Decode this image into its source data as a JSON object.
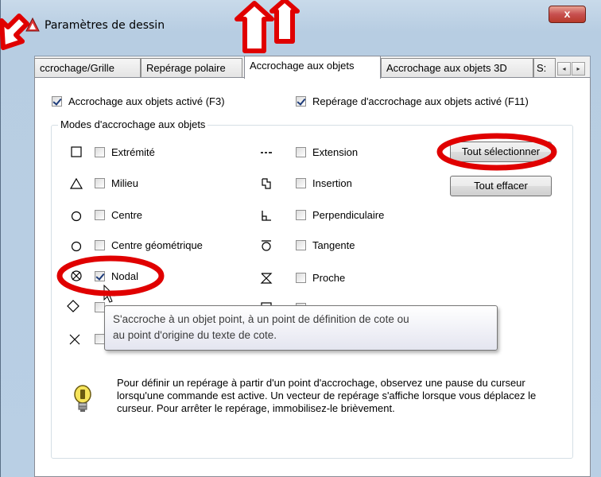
{
  "window": {
    "title": "Paramètres de dessin",
    "close_label": "x",
    "app_icon": "autocad-icon"
  },
  "tabs": [
    {
      "label": "ccrochage/Grille",
      "active": false
    },
    {
      "label": "Repérage polaire",
      "active": false
    },
    {
      "label": "Accrochage aux objets",
      "active": true
    },
    {
      "label": "Accrochage aux objets 3D",
      "active": false
    },
    {
      "label": "S:",
      "active": false
    }
  ],
  "tab_scroll": {
    "left": "◂",
    "right": "▸"
  },
  "options": {
    "osnap_on": {
      "label": "Accrochage aux objets activé (F3)",
      "checked": true
    },
    "tracking_on": {
      "label": "Repérage d'accrochage aux objets activé (F11)",
      "checked": true
    }
  },
  "modes_group_title": "Modes d'accrochage aux objets",
  "modes_left": [
    {
      "symbol": "square-icon",
      "label": "Extrémité",
      "checked": false
    },
    {
      "symbol": "triangle-icon",
      "label": "Milieu",
      "checked": false
    },
    {
      "symbol": "circle-icon",
      "label": "Centre",
      "checked": false
    },
    {
      "symbol": "circle-icon",
      "label": "Centre géométrique",
      "checked": false
    },
    {
      "symbol": "node-icon",
      "label": "Nodal",
      "checked": true
    },
    {
      "symbol": "diamond-icon",
      "label": "",
      "checked": false
    },
    {
      "symbol": "cross-icon",
      "label": "",
      "checked": false
    }
  ],
  "modes_right": [
    {
      "symbol": "extension-icon",
      "label": "Extension",
      "checked": false
    },
    {
      "symbol": "insertion-icon",
      "label": "Insertion",
      "checked": false
    },
    {
      "symbol": "perpendicular-icon",
      "label": "Perpendiculaire",
      "checked": false
    },
    {
      "symbol": "tangent-icon",
      "label": "Tangente",
      "checked": false
    },
    {
      "symbol": "nearest-icon",
      "label": "Proche",
      "checked": false
    }
  ],
  "buttons": {
    "select_all": "Tout sélectionner",
    "clear_all": "Tout effacer"
  },
  "tooltip": {
    "line1": "S'accroche à un objet point, à un point de définition de cote ou",
    "line2": "au point d'origine du texte de cote."
  },
  "info": {
    "icon": "lightbulb-icon",
    "text": "Pour définir un repérage à partir d'un point d'accrochage, observez une pause du curseur lorsqu'une commande est active. Un vecteur de repérage s'affiche lorsque vous déplacez le curseur. Pour arrêter le repérage, immobilisez-le brièvement."
  },
  "colors": {
    "annotation_red": "#e00000",
    "frame": "#b9cfe4",
    "close_button": "#c75050"
  }
}
